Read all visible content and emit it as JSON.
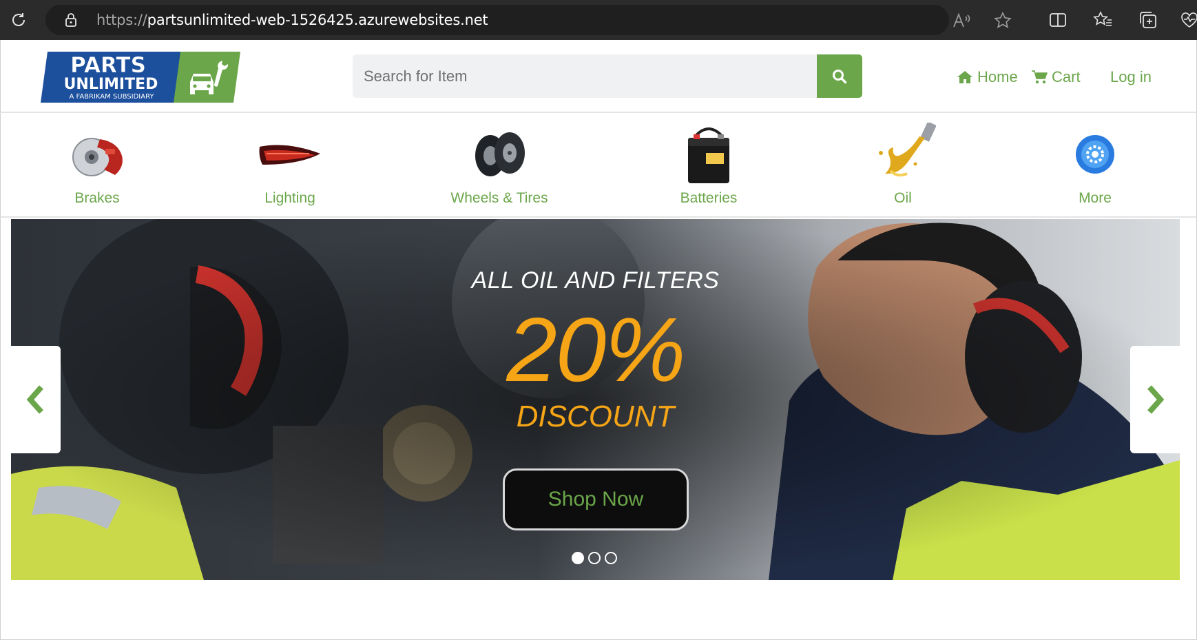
{
  "browser": {
    "url_scheme": "https://",
    "url_host": "partsunlimited-web-1526425.azurewebsites.net"
  },
  "header": {
    "logo": {
      "line1": "PARTS",
      "line2": "UNLIMITED",
      "tagline": "A FABRIKAM SUBSIDIARY"
    },
    "search": {
      "placeholder": "Search for Item"
    },
    "nav": {
      "home": "Home",
      "cart": "Cart",
      "login": "Log in"
    }
  },
  "categories": [
    {
      "label": "Brakes",
      "icon": "brakes-icon"
    },
    {
      "label": "Lighting",
      "icon": "tail-light-icon"
    },
    {
      "label": "Wheels & Tires",
      "icon": "tires-icon"
    },
    {
      "label": "Batteries",
      "icon": "battery-icon"
    },
    {
      "label": "Oil",
      "icon": "oil-pour-icon"
    },
    {
      "label": "More",
      "icon": "more-gear-icon"
    }
  ],
  "hero": {
    "kicker": "ALL OIL AND FILTERS",
    "percent": "20%",
    "discount": "DISCOUNT",
    "button": "Shop Now",
    "slides": 3,
    "active_slide": 1
  },
  "colors": {
    "brand_green": "#6ba64a",
    "brand_blue": "#1c4f9c",
    "accent_orange": "#f5a516"
  }
}
